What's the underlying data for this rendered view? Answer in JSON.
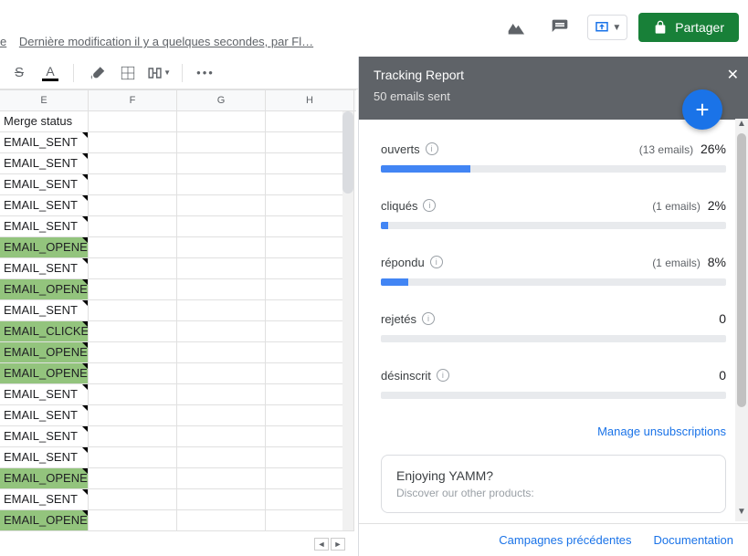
{
  "topbar": {
    "edit_marker": "e",
    "last_modified": "Dernière modification il y a quelques secondes, par Fl…",
    "share_label": "Partager"
  },
  "columns": [
    "E",
    "F",
    "G",
    "H"
  ],
  "header_cell": "Merge status",
  "rows": [
    {
      "text": "EMAIL_SENT",
      "green": false
    },
    {
      "text": "EMAIL_SENT",
      "green": false
    },
    {
      "text": "EMAIL_SENT",
      "green": false
    },
    {
      "text": "EMAIL_SENT",
      "green": false
    },
    {
      "text": "EMAIL_SENT",
      "green": false
    },
    {
      "text": "EMAIL_OPENED",
      "green": true
    },
    {
      "text": "EMAIL_SENT",
      "green": false
    },
    {
      "text": "EMAIL_OPENED",
      "green": true
    },
    {
      "text": "EMAIL_SENT",
      "green": false
    },
    {
      "text": "EMAIL_CLICKED",
      "green": true
    },
    {
      "text": "EMAIL_OPENED",
      "green": true
    },
    {
      "text": "EMAIL_OPENED",
      "green": true
    },
    {
      "text": "EMAIL_SENT",
      "green": false
    },
    {
      "text": "EMAIL_SENT",
      "green": false
    },
    {
      "text": "EMAIL_SENT",
      "green": false
    },
    {
      "text": "EMAIL_SENT",
      "green": false
    },
    {
      "text": "EMAIL_OPENED",
      "green": true
    },
    {
      "text": "EMAIL_SENT",
      "green": false
    },
    {
      "text": "EMAIL_OPENED",
      "green": true
    }
  ],
  "panel": {
    "title": "Tracking Report",
    "subtitle": "50 emails sent",
    "metrics": [
      {
        "label": "ouverts",
        "detail": "(13 emails)",
        "pct": "26%",
        "fill": 26
      },
      {
        "label": "cliqués",
        "detail": "(1 emails)",
        "pct": "2%",
        "fill": 2
      },
      {
        "label": "répondu",
        "detail": "(1 emails)",
        "pct": "8%",
        "fill": 8
      },
      {
        "label": "rejetés",
        "detail": "",
        "pct": "0",
        "fill": 0
      },
      {
        "label": "désinscrit",
        "detail": "",
        "pct": "0",
        "fill": 0
      }
    ],
    "manage_link": "Manage unsubscriptions",
    "promo_title": "Enjoying YAMM?",
    "promo_sub": "Discover our other products:",
    "footer_prev": "Campagnes précédentes",
    "footer_doc": "Documentation"
  }
}
